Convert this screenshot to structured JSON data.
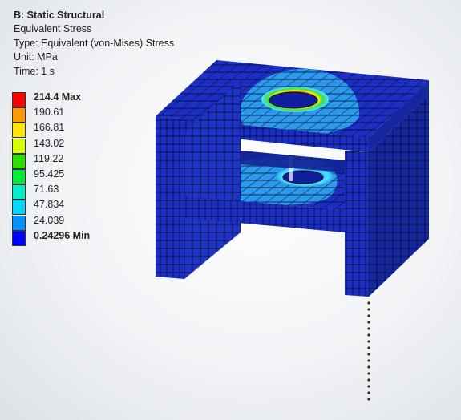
{
  "header": {
    "title": "B: Static Structural",
    "result": "Equivalent Stress",
    "type_line": "Type: Equivalent (von-Mises) Stress",
    "unit_line": "Unit: MPa",
    "time_line": "Time: 1 s"
  },
  "legend": [
    {
      "label": "214.4 Max",
      "color": "#ff0000",
      "bold": true
    },
    {
      "label": "190.61",
      "color": "#ff9a00",
      "bold": false
    },
    {
      "label": "166.81",
      "color": "#ffe600",
      "bold": false
    },
    {
      "label": "143.02",
      "color": "#d8ff00",
      "bold": false
    },
    {
      "label": "119.22",
      "color": "#2ddf00",
      "bold": false
    },
    {
      "label": "95.425",
      "color": "#00ec3a",
      "bold": false
    },
    {
      "label": "71.63",
      "color": "#00f0c8",
      "bold": false
    },
    {
      "label": "47.834",
      "color": "#00d7ff",
      "bold": false
    },
    {
      "label": "24.039",
      "color": "#0093ff",
      "bold": false
    },
    {
      "label": "0.24296 Min",
      "color": "#0000ff",
      "bold": true
    }
  ],
  "colors": {
    "mesh_blue": "#1b2fc6",
    "mesh_blue_dark": "#0f1f9e",
    "stress_light": "#2ba0f0",
    "stress_cyan": "#4fe0ff",
    "stress_green": "#3ee050",
    "stress_yellow": "#f5f000",
    "stress_red": "#ff2a00",
    "mesh_line": "#0a0a28",
    "probe_dot": "#3a2a1a"
  }
}
